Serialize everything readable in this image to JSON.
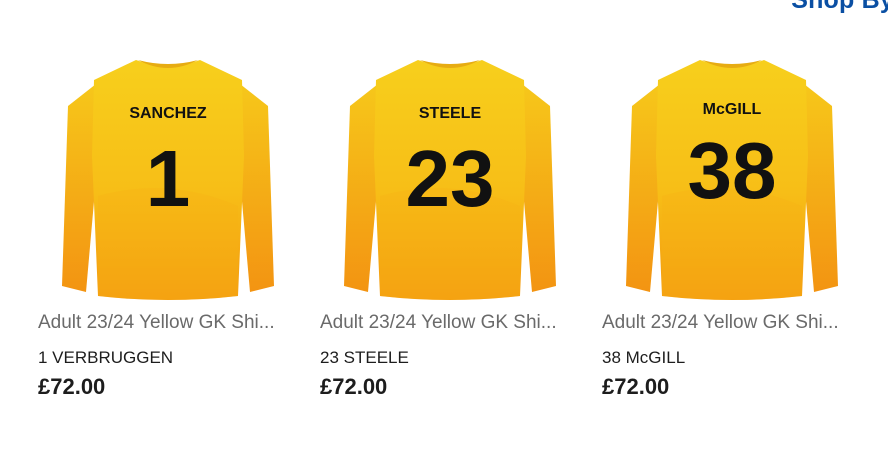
{
  "header": {
    "shop_by_label": "Shop By"
  },
  "colors": {
    "accent": "#0a4fa3",
    "shirt_yellow": "#f7c419",
    "shirt_orange": "#f59a0f",
    "number_black": "#111111"
  },
  "products": [
    {
      "name_on_shirt": "SANCHEZ",
      "number_on_shirt": "1",
      "title": "Adult 23/24 Yellow GK Shi...",
      "personalisation": "1 VERBRUGGEN",
      "price": "£72.00"
    },
    {
      "name_on_shirt": "STEELE",
      "number_on_shirt": "23",
      "title": "Adult 23/24 Yellow GK Shi...",
      "personalisation": "23 STEELE",
      "price": "£72.00"
    },
    {
      "name_on_shirt": "McGILL",
      "number_on_shirt": "38",
      "title": "Adult 23/24 Yellow GK Shi...",
      "personalisation": "38 McGILL",
      "price": "£72.00"
    }
  ]
}
